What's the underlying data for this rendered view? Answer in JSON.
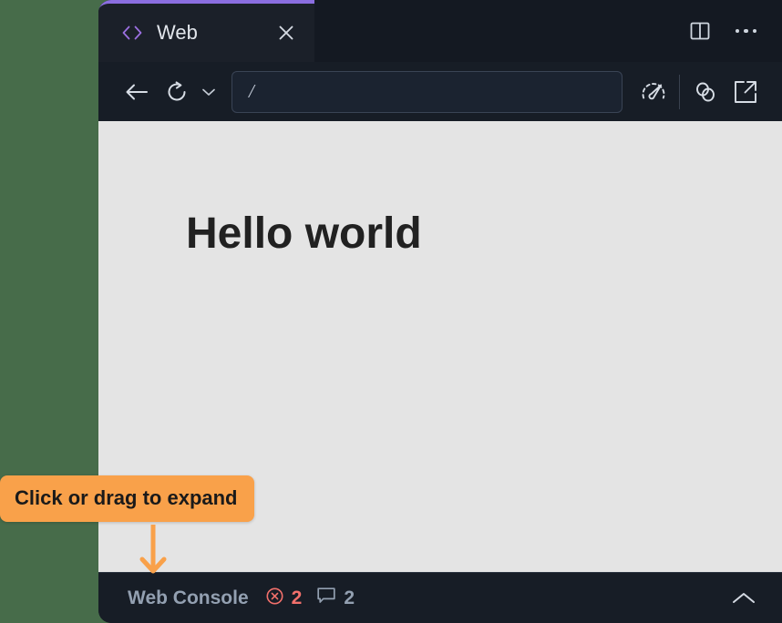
{
  "window": {
    "background_color": "#476c4a",
    "chrome_color": "#171d26"
  },
  "tab_strip": {
    "active_tab": {
      "icon": "code-brackets-icon",
      "label": "Web",
      "close_icon": "close-icon",
      "accent_color": "#8b6ee0"
    },
    "actions": [
      {
        "icon": "split-pane-icon",
        "label": "Split pane"
      },
      {
        "icon": "more-options-icon",
        "label": "More options"
      }
    ]
  },
  "toolbar": {
    "back": {
      "icon": "back-arrow-icon",
      "label": "Back"
    },
    "reload": {
      "icon": "reload-icon",
      "label": "Reload"
    },
    "reload_menu": {
      "icon": "chevron-down-icon",
      "label": "Reload options"
    },
    "url": {
      "value": "/",
      "placeholder": "/"
    },
    "performance": {
      "icon": "speedometer-icon",
      "label": "Performance"
    },
    "link": {
      "icon": "link-icon",
      "label": "Copy link"
    },
    "open_external": {
      "icon": "external-link-icon",
      "label": "Open in browser"
    }
  },
  "page": {
    "heading": "Hello world",
    "background_color": "#e4e4e4"
  },
  "console": {
    "title": "Web Console",
    "stats": [
      {
        "icon": "error-circle-icon",
        "count": "2",
        "type": "errors",
        "color": "#f2706b"
      },
      {
        "icon": "message-bubble-icon",
        "count": "2",
        "type": "messages",
        "color": "#93a0b1"
      }
    ],
    "expand": {
      "icon": "chevron-up-icon",
      "label": "Expand console"
    }
  },
  "annotation": {
    "text": "Click or drag to expand",
    "background_color": "#f9a14a",
    "arrow": "down-arrow-icon"
  }
}
